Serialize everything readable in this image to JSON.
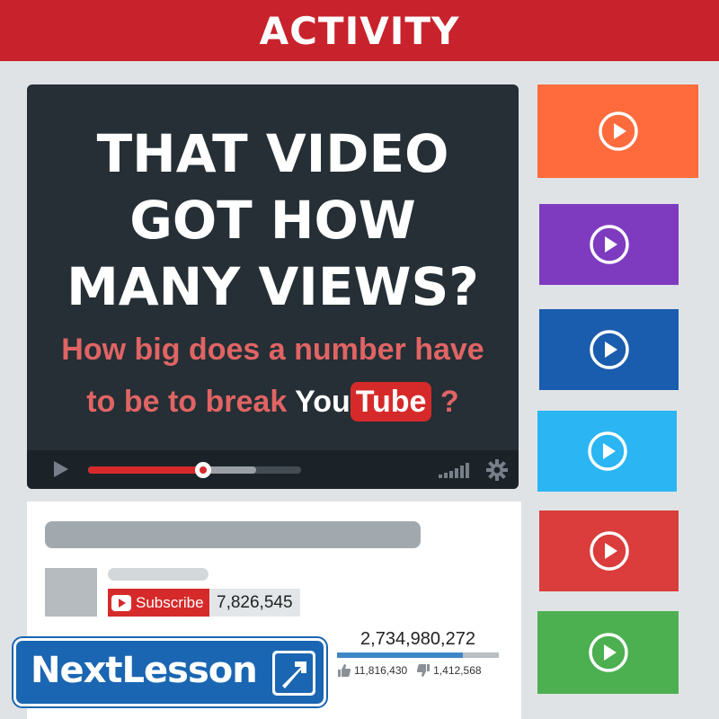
{
  "header": {
    "title": "ACTIVITY"
  },
  "video": {
    "headline": [
      "THAT VIDEO",
      "GOT HOW",
      "MANY VIEWS?"
    ],
    "subline_1": "How big does a number have",
    "subline_2_prefix": "to be to break ",
    "logo_you": "You",
    "logo_tube": "Tube",
    "subline_2_suffix": " ?",
    "progress_fraction": 0.54,
    "buffer_fraction": 0.79
  },
  "sidebar_thumbnails": [
    {
      "color": "#ff6b3d"
    },
    {
      "color": "#7e3bc0"
    },
    {
      "color": "#1a5cad"
    },
    {
      "color": "#2bb5f2"
    },
    {
      "color": "#db3c3c"
    },
    {
      "color": "#4caf50"
    }
  ],
  "channel": {
    "subscribe_label": "Subscribe",
    "subscriber_count": "7,826,545"
  },
  "stats": {
    "views": "2,734,980,272",
    "likes": "11,816,430",
    "dislikes": "1,412,568",
    "like_fraction": 0.78
  },
  "brand": {
    "logo_text": "NextLesson"
  }
}
